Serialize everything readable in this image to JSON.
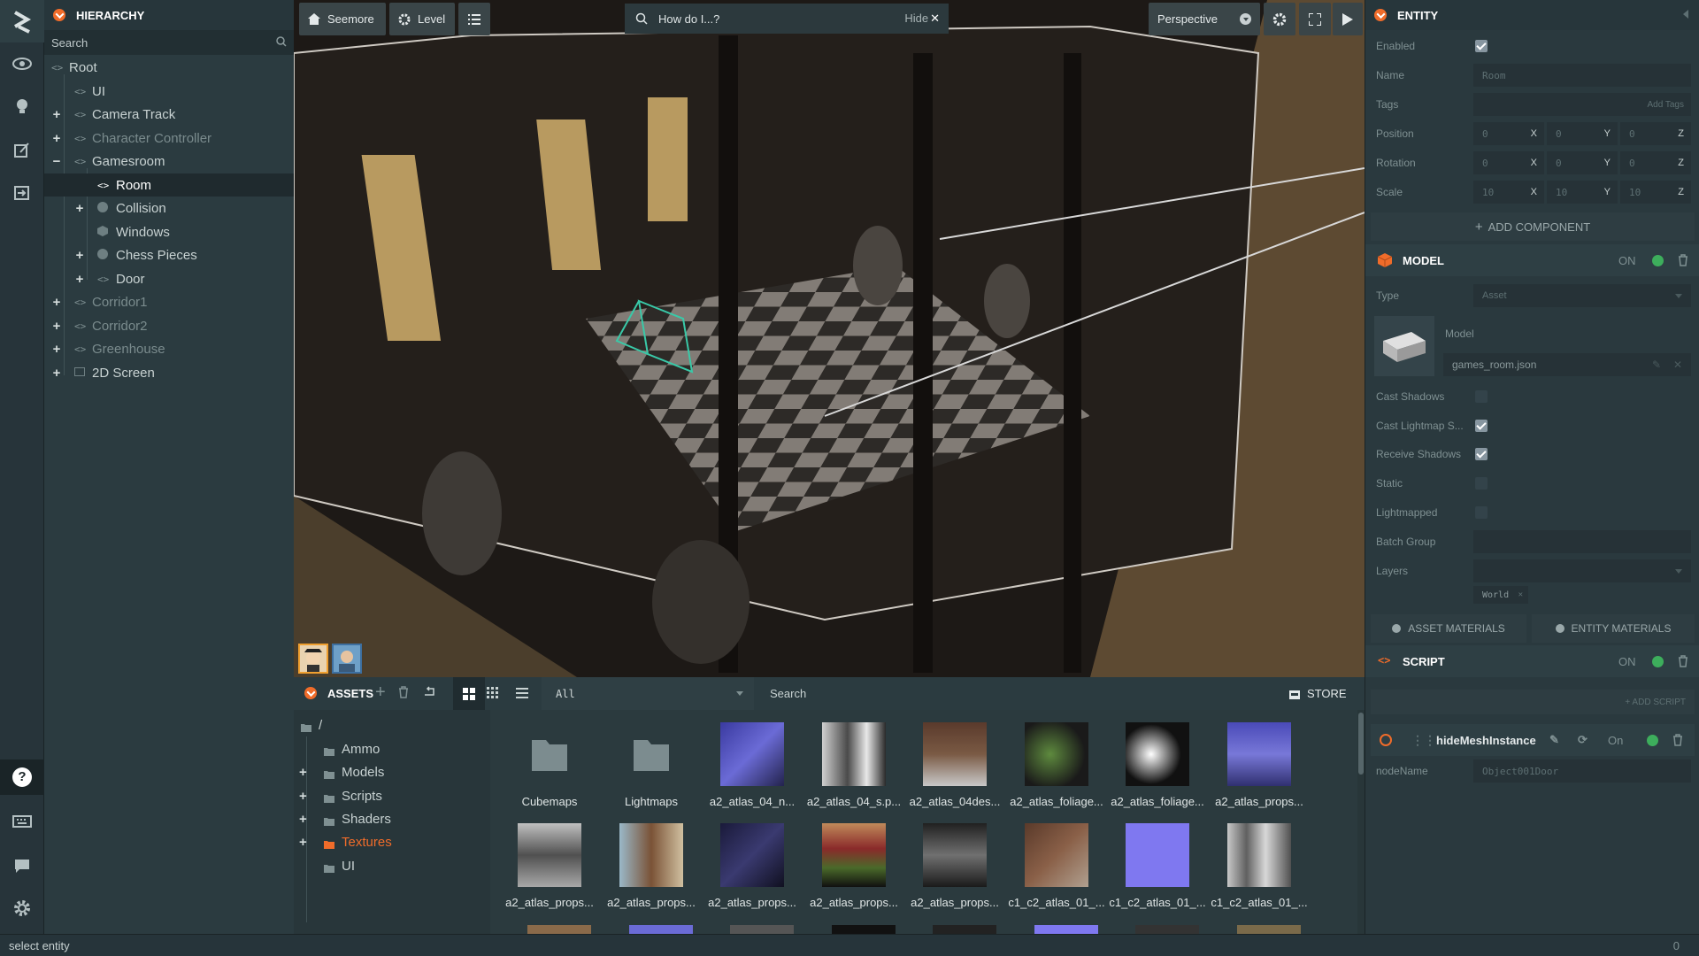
{
  "hierarchy": {
    "title": "HIERARCHY",
    "search_placeholder": "Search",
    "items": [
      {
        "label": "Root",
        "expander": ""
      },
      {
        "label": "UI",
        "expander": ""
      },
      {
        "label": "Camera Track",
        "expander": "+"
      },
      {
        "label": "Character Controller",
        "expander": "+"
      },
      {
        "label": "Gamesroom",
        "expander": "−"
      },
      {
        "label": "Room",
        "expander": ""
      },
      {
        "label": "Collision",
        "expander": "+"
      },
      {
        "label": "Windows",
        "expander": ""
      },
      {
        "label": "Chess Pieces",
        "expander": "+"
      },
      {
        "label": "Door",
        "expander": "+"
      },
      {
        "label": "Corridor1",
        "expander": "+"
      },
      {
        "label": "Corridor2",
        "expander": "+"
      },
      {
        "label": "Greenhouse",
        "expander": "+"
      },
      {
        "label": "2D Screen",
        "expander": "+"
      }
    ]
  },
  "viewport": {
    "seemore_label": "Seemore",
    "level_label": "Level",
    "howdoi_placeholder": "How do I...?",
    "hide_label": "Hide",
    "camera_label": "Perspective"
  },
  "assets": {
    "title": "ASSETS",
    "filter_value": "All",
    "search_placeholder": "Search",
    "store_label": "STORE",
    "root": "/",
    "folders": [
      {
        "label": "Ammo",
        "expander": ""
      },
      {
        "label": "Models",
        "expander": "+"
      },
      {
        "label": "Scripts",
        "expander": "+"
      },
      {
        "label": "Shaders",
        "expander": "+"
      },
      {
        "label": "Textures",
        "expander": "+"
      },
      {
        "label": "UI",
        "expander": ""
      }
    ],
    "tiles_row1": [
      "Cubemaps",
      "Lightmaps",
      "a2_atlas_04_n...",
      "a2_atlas_04_s.p...",
      "a2_atlas_04des...",
      "a2_atlas_foliage...",
      "a2_atlas_foliage...",
      "a2_atlas_props..."
    ],
    "tiles_row2": [
      "a2_atlas_props...",
      "a2_atlas_props...",
      "a2_atlas_props...",
      "a2_atlas_props...",
      "a2_atlas_props...",
      "c1_c2_atlas_01_...",
      "c1_c2_atlas_01_...",
      "c1_c2_atlas_01_..."
    ]
  },
  "inspector": {
    "entity_title": "ENTITY",
    "labels": {
      "enabled": "Enabled",
      "name": "Name",
      "tags": "Tags",
      "position": "Position",
      "rotation": "Rotation",
      "scale": "Scale"
    },
    "name_value": "Room",
    "add_tags": "Add Tags",
    "position": [
      "0",
      "0",
      "0"
    ],
    "rotation": [
      "0",
      "0",
      "0"
    ],
    "scale": [
      "10",
      "10",
      "10"
    ],
    "axes": [
      "X",
      "Y",
      "Z"
    ],
    "add_component": "ADD COMPONENT",
    "model": {
      "title": "MODEL",
      "on_label": "ON",
      "type_label": "Type",
      "type_value": "Asset",
      "model_label": "Model",
      "model_value": "games_room.json",
      "cast_shadows": "Cast Shadows",
      "cast_lightmap": "Cast Lightmap S...",
      "receive_shadows": "Receive Shadows",
      "static": "Static",
      "lightmapped": "Lightmapped",
      "batch_group": "Batch Group",
      "layers": "Layers",
      "layer_tag": "World",
      "asset_materials": "ASSET MATERIALS",
      "entity_materials": "ENTITY MATERIALS"
    },
    "script": {
      "title": "SCRIPT",
      "on_label": "ON",
      "add_script": "+ ADD SCRIPT",
      "script_name": "hideMeshInstance",
      "script_on": "On",
      "attr_label": "nodeName",
      "attr_value": "Object001Door"
    }
  },
  "status": {
    "text": "select entity",
    "count": "0"
  },
  "colors": {
    "accent": "#f06c2a",
    "toggle_on": "#3dae5c"
  }
}
